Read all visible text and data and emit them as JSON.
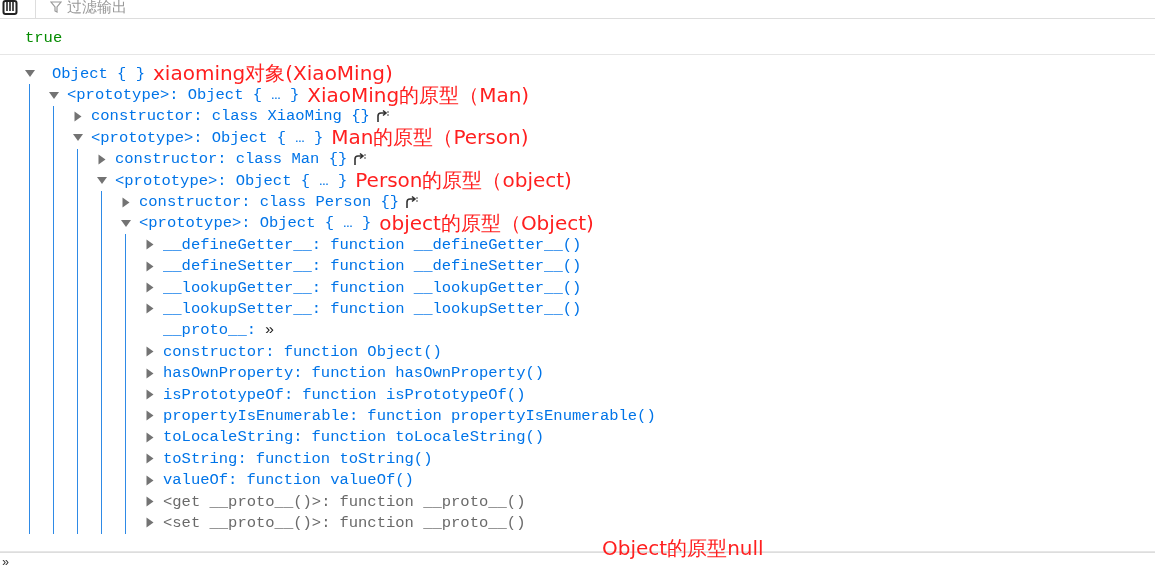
{
  "toolbar": {
    "filter_placeholder": "过滤输出"
  },
  "log": {
    "value": "true"
  },
  "tree": {
    "kind": "root",
    "value": "Object {   }",
    "expanded": true,
    "note": "xiaoming对象(XiaoMing)",
    "children": [
      {
        "kind": "property",
        "key": "<prototype>:",
        "value": "Object { … }",
        "expanded": true,
        "note": "XiaoMing的原型（Man)",
        "children": [
          {
            "kind": "property",
            "key": "constructor:",
            "value": "class XiaoMing {}",
            "expanded": false,
            "jump": true
          },
          {
            "kind": "property",
            "key": "<prototype>:",
            "value": "Object { … }",
            "expanded": true,
            "note": "Man的原型（Person)",
            "children": [
              {
                "kind": "property",
                "key": "constructor:",
                "value": "class Man {}",
                "expanded": false,
                "jump": true
              },
              {
                "kind": "property",
                "key": "<prototype>:",
                "value": "Object { … }",
                "expanded": true,
                "note": "Person的原型（object)",
                "children": [
                  {
                    "kind": "property",
                    "key": "constructor:",
                    "value": "class Person {}",
                    "expanded": false,
                    "jump": true
                  },
                  {
                    "kind": "property",
                    "key": "<prototype>:",
                    "value": "Object { … }",
                    "expanded": true,
                    "note": "object的原型（Object)",
                    "children": [
                      {
                        "kind": "property",
                        "key": "__defineGetter__:",
                        "value": "function __defineGetter__()",
                        "expanded": false
                      },
                      {
                        "kind": "property",
                        "key": "__defineSetter__:",
                        "value": "function __defineSetter__()",
                        "expanded": false
                      },
                      {
                        "kind": "property",
                        "key": "__lookupGetter__:",
                        "value": "function __lookupGetter__()",
                        "expanded": false
                      },
                      {
                        "kind": "property",
                        "key": "__lookupSetter__:",
                        "value": "function __lookupSetter__()",
                        "expanded": false
                      },
                      {
                        "kind": "link",
                        "key": "__proto__:",
                        "value": "»"
                      },
                      {
                        "kind": "property",
                        "key": "constructor:",
                        "value": "function Object()",
                        "expanded": false
                      },
                      {
                        "kind": "property",
                        "key": "hasOwnProperty:",
                        "value": "function hasOwnProperty()",
                        "expanded": false
                      },
                      {
                        "kind": "property",
                        "key": "isPrototypeOf:",
                        "value": "function isPrototypeOf()",
                        "expanded": false
                      },
                      {
                        "kind": "property",
                        "key": "propertyIsEnumerable:",
                        "value": "function propertyIsEnumerable()",
                        "expanded": false
                      },
                      {
                        "kind": "property",
                        "key": "toLocaleString:",
                        "value": "function toLocaleString()",
                        "expanded": false
                      },
                      {
                        "kind": "property",
                        "key": "toString:",
                        "value": "function toString()",
                        "expanded": false
                      },
                      {
                        "kind": "property",
                        "key": "valueOf:",
                        "value": "function valueOf()",
                        "expanded": false
                      },
                      {
                        "kind": "accessor",
                        "key": "<get __proto__()>:",
                        "value": "function __proto__()",
                        "expanded": false
                      },
                      {
                        "kind": "accessor",
                        "key": "<set __proto__()>:",
                        "value": "function __proto__()",
                        "expanded": false
                      }
                    ]
                  }
                ]
              }
            ]
          }
        ]
      }
    ]
  },
  "bottom_note": "Object的原型null",
  "prompt": "»"
}
